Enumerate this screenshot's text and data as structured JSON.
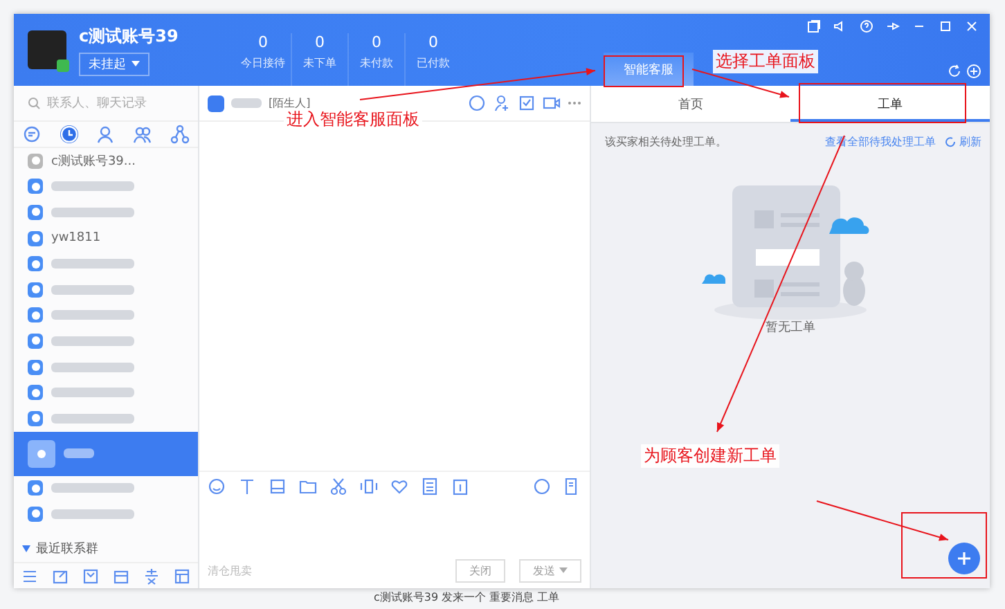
{
  "account": {
    "name": "c测试账号39",
    "status": "未挂起",
    "online": true
  },
  "stats": [
    {
      "value": "0",
      "label": "今日接待"
    },
    {
      "value": "0",
      "label": "未下单"
    },
    {
      "value": "0",
      "label": "未付款"
    },
    {
      "value": "0",
      "label": "已付款"
    }
  ],
  "header_tab": {
    "label": "智能客服",
    "selected": true
  },
  "search": {
    "placeholder": "联系人、聊天记录"
  },
  "contact_tabs": [
    {
      "selected": false
    },
    {
      "selected": true
    },
    {
      "selected": false
    },
    {
      "selected": false
    },
    {
      "selected": false
    }
  ],
  "contacts": [
    {
      "kind": "named",
      "name": "c测试账号39...",
      "online": false,
      "selected": false
    },
    {
      "kind": "blurred",
      "online": true,
      "selected": false
    },
    {
      "kind": "blurred",
      "online": true,
      "selected": false
    },
    {
      "kind": "named",
      "name": "yw1811",
      "online": true,
      "selected": false
    },
    {
      "kind": "blurred",
      "online": true,
      "selected": false
    },
    {
      "kind": "blurred",
      "online": true,
      "selected": false
    },
    {
      "kind": "blurred",
      "online": true,
      "selected": false
    },
    {
      "kind": "blurred",
      "online": true,
      "selected": false
    },
    {
      "kind": "blurred",
      "online": true,
      "selected": false
    },
    {
      "kind": "blurred",
      "online": true,
      "selected": false
    },
    {
      "kind": "blurred",
      "online": true,
      "selected": false
    },
    {
      "kind": "blurred",
      "online": true,
      "selected": true
    },
    {
      "kind": "blurred",
      "online": true,
      "selected": false
    },
    {
      "kind": "blurred",
      "online": true,
      "selected": false
    }
  ],
  "group": {
    "label": "最近联系群",
    "expanded": true
  },
  "chat": {
    "contact_tag": "[陌生人]",
    "placeholder": "清仓甩卖",
    "buttons": [
      {
        "label": "关闭",
        "dropdown": false
      },
      {
        "label": "发送",
        "dropdown": true
      }
    ]
  },
  "panel": {
    "tabs": [
      {
        "label": "首页",
        "selected": false
      },
      {
        "label": "工单",
        "selected": true
      }
    ],
    "note": "该买家相关待处理工单。",
    "link": "查看全部待我处理工单",
    "refresh": "刷新",
    "empty": "暂无工单"
  },
  "status_line": "c测试账号39 发来一个 重要消息 工单",
  "annotations": [
    {
      "text": "进入智能客服面板"
    },
    {
      "text": "选择工单面板"
    },
    {
      "text": "为顾客创建新工单"
    }
  ]
}
